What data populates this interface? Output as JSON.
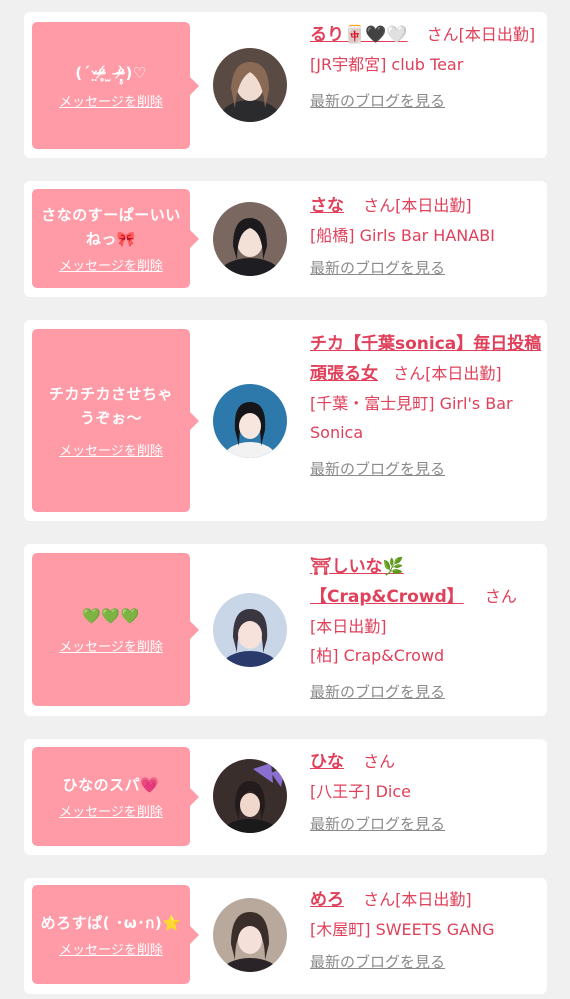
{
  "delete_label": "メッセージを削除",
  "blog_label": "最新のブログを見る",
  "san_label": "さん",
  "cards": [
    {
      "message": "(ˊᵕ̤ᵒ̴̶̷̥́ ̫ ᵒ̴̶̷̣̥̀)♡",
      "name": "るり🀄🖤🤍",
      "status": "[本日出勤]",
      "shop": "[JR宇都宮] club Tear"
    },
    {
      "message": "さなのすーぱーいいねっ🎀",
      "name": "さな",
      "status": "[本日出勤]",
      "shop": "[船橋] Girls Bar HANABI"
    },
    {
      "message": "チカチカさせちゃうぞぉ〜",
      "name": "チカ【千葉sonica】毎日投稿頑張る女",
      "status": "[本日出勤]",
      "shop": "[千葉・富士見町] Girl's Bar Sonica"
    },
    {
      "message": "💚💚💚",
      "name": "⛩しいな🌿【Crap&Crowd】",
      "status": "[本日出勤]",
      "shop": "[柏] Crap&Crowd"
    },
    {
      "message": "ひなのスパ💗",
      "name": "ひな",
      "status": "",
      "shop": "[八王子] Dice"
    },
    {
      "message": "めろすぱ( ･ω･ก)⭐",
      "name": "めろ",
      "status": "[本日出勤]",
      "shop": "[木屋町] SWEETS GANG"
    }
  ]
}
